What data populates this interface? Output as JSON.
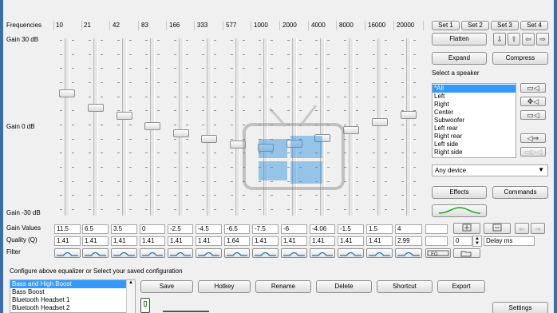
{
  "frequencies": {
    "label": "Frequencies",
    "values": [
      "10",
      "21",
      "42",
      "83",
      "166",
      "333",
      "577",
      "1000",
      "2000",
      "4000",
      "8000",
      "16000",
      "20000"
    ]
  },
  "gain_axis": {
    "top": "Gain 30 dB",
    "mid": "Gain 0 dB",
    "bottom": "Gain -30 dB"
  },
  "gain_values": {
    "label": "Gain Values",
    "values": [
      "11.5",
      "6.5",
      "3.5",
      "0",
      "-2.5",
      "-4.5",
      "-6.5",
      "-7.5",
      "-6",
      "-4.06",
      "-1.5",
      "1.5",
      "4"
    ],
    "numeric": [
      11.5,
      6.5,
      3.5,
      0,
      -2.5,
      -4.5,
      -6.5,
      -7.5,
      -6,
      -4.06,
      -1.5,
      1.5,
      4
    ]
  },
  "quality": {
    "label": "Quality (Q)",
    "values": [
      "1.41",
      "1.41",
      "1.41",
      "1.41",
      "1.41",
      "1.41",
      "1.64",
      "1.41",
      "1.41",
      "1.41",
      "1.41",
      "1.41",
      "2.99"
    ]
  },
  "filter": {
    "label": "Filter"
  },
  "sets": [
    "Set 1",
    "Set 2",
    "Set 3",
    "Set 4"
  ],
  "buttons": {
    "flatten": "Flatten",
    "expand": "Expand",
    "compress": "Compress",
    "effects": "Effects",
    "commands": "Commands",
    "settings": "Settings"
  },
  "speaker": {
    "label": "Select a speaker",
    "items": [
      "*All",
      "Left",
      "Right",
      "Center",
      "Subwoofer",
      "Left rear",
      "Right rear",
      "Left side",
      "Right side"
    ],
    "selected": 0
  },
  "device": {
    "value": "Any device"
  },
  "delay": {
    "value": "0",
    "label": "Delay ms"
  },
  "config": {
    "label": "Configure above equalizer or Select your saved configuration",
    "items": [
      "Bass and High Boost",
      "Bass Boost",
      "Bluetooth Headset 1",
      "Bluetooth Headset 2"
    ],
    "selected": 0
  },
  "actions": [
    "Save",
    "Hotkey",
    "Rename",
    "Delete",
    "Shortcut",
    "Export"
  ],
  "colors": {
    "accent": "#3399ff",
    "filter_curve": "#1f6fb5",
    "effect_curve": "#1aa31a",
    "window_edge": "#3a6ea5"
  }
}
